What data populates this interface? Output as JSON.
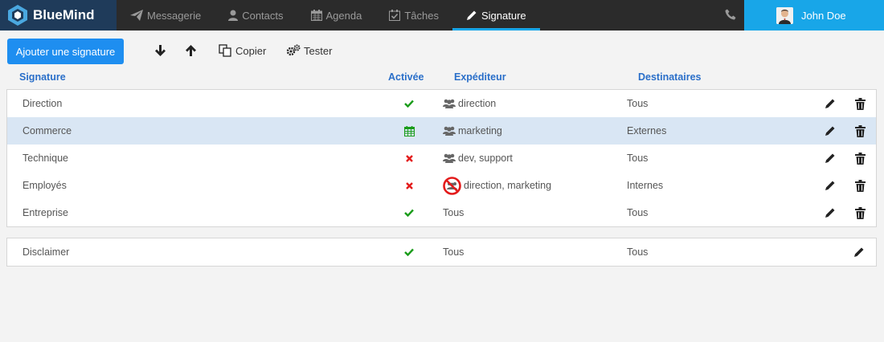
{
  "app": {
    "brand": "BlueMind"
  },
  "nav": [
    {
      "label": "Messagerie",
      "icon": "paper-plane-icon"
    },
    {
      "label": "Contacts",
      "icon": "person-icon"
    },
    {
      "label": "Agenda",
      "icon": "calendar-icon"
    },
    {
      "label": "Tâches",
      "icon": "checkbox-calendar-icon"
    },
    {
      "label": "Signature",
      "icon": "pencil-icon",
      "active": true
    }
  ],
  "user": {
    "name": "John Doe"
  },
  "toolbar": {
    "add_label": "Ajouter une signature",
    "copy_label": "Copier",
    "test_label": "Tester"
  },
  "headers": {
    "signature": "Signature",
    "active": "Activée",
    "sender": "Expéditeur",
    "recipients": "Destinataires"
  },
  "rows": [
    {
      "name": "Direction",
      "status": "enabled",
      "sender": "direction",
      "sender_icon": "group-icon",
      "recipients": "Tous"
    },
    {
      "name": "Commerce",
      "status": "scheduled",
      "sender": "marketing",
      "sender_icon": "group-icon",
      "recipients": "Externes",
      "selected": true
    },
    {
      "name": "Technique",
      "status": "disabled",
      "sender": "dev, support",
      "sender_icon": "group-icon",
      "recipients": "Tous"
    },
    {
      "name": "Employés",
      "status": "disabled",
      "sender": "direction, marketing",
      "sender_icon": "forbidden-group-icon",
      "recipients": "Internes"
    },
    {
      "name": "Entreprise",
      "status": "enabled",
      "sender": "Tous",
      "sender_icon": "",
      "recipients": "Tous"
    }
  ],
  "disclaimer": {
    "name": "Disclaimer",
    "status": "enabled",
    "sender": "Tous",
    "recipients": "Tous"
  },
  "colors": {
    "brand_bg": "#1f3b5a",
    "accent": "#18a6e8",
    "button": "#1e8ef0",
    "enabled": "#1a9c1a",
    "disabled": "#e31b1b",
    "header_text": "#2a6fc9",
    "selected_row": "#d9e6f4"
  }
}
